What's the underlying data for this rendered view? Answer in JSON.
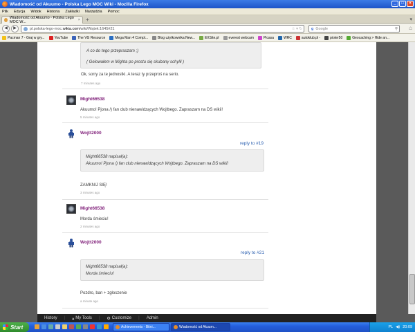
{
  "window": {
    "title": "Wiadomość od Akuumo - Polska Lego MOC Wiki - Mozilla Firefox"
  },
  "menu": [
    "Plik",
    "Edycja",
    "Widok",
    "Historia",
    "Zakładki",
    "Narzędzia",
    "Pomoc"
  ],
  "tab": {
    "label": "Wiadomość od Akuumo - Polska Lego MOC W...",
    "close": "×",
    "new_tab": "+"
  },
  "nav": {
    "url_prefix": "pl.polska-lego-moc.",
    "url_domain": "wikia.com",
    "url_suffix": "/wiki/Wątek:1645#21",
    "search_engine": "g",
    "search_placeholder": "Google"
  },
  "bookmarks": [
    {
      "label": "Pacman 7 - Graj w gry...",
      "color": "#f2c218"
    },
    {
      "label": "YouTube",
      "color": "#d22"
    },
    {
      "label": "The VG Resource",
      "color": "#3a63b8"
    },
    {
      "label": "Mega Man 4 Compl...",
      "color": "#2b6fc2"
    },
    {
      "label": "Blog użytkownika:New...",
      "color": "#888"
    },
    {
      "label": "EXSite.pl",
      "color": "#7a4"
    },
    {
      "label": "everest webcam",
      "color": "#999"
    },
    {
      "label": "Picasa",
      "color": "#c4c"
    },
    {
      "label": "WRC",
      "color": "#26a"
    },
    {
      "label": "autoklub.pl -",
      "color": "#c33"
    },
    {
      "label": "pioter50",
      "color": "#444"
    },
    {
      "label": "Geocaching > Hide an...",
      "color": "#5a3"
    }
  ],
  "thread": {
    "top_quote_lines": [
      "A co do tego przepraszam ;)",
      "( Gelowałem w Mighta po prostu się skubany schylił )"
    ],
    "top_text": "Ok, sorry za te jednostki. A teraz ty przeproś na serio.",
    "top_time": "7 minutes ago",
    "posts": [
      {
        "user": "Might66538",
        "text": "Akuumo! Pjona /) fan club nienawidzących Wojtbego. Zapraszam na DS wikii!",
        "time": "5 minutes ago"
      },
      {
        "user": "Wojtt2000",
        "reply": "reply to #19",
        "quote_lines": [
          "Might66538 napisał(a):",
          "Akuumo! Pjona /) fan club nienawidzących Wojtbego. Zapraszam na DS wikii!"
        ],
        "text": "ZAMKNIJ SIĘ!",
        "time": "3 minutes ago"
      },
      {
        "user": "Might66538",
        "text": "Morda śmieciu!",
        "time": "2 minutes ago"
      },
      {
        "user": "Wojtt2000",
        "reply": "reply to #21",
        "quote_lines": [
          "Might66538 napisał(a):",
          "Morda śmieciu!"
        ],
        "text": "Pozdro, ban + zgłoszenie",
        "time": "a minute ago"
      }
    ]
  },
  "wikia_toolbar": {
    "history": "History",
    "my_tools": "My Tools",
    "customize": "Customize",
    "admin": "Admin"
  },
  "taskbar": {
    "start": "Start",
    "buttons": [
      {
        "label": "Achievements - Bitni..."
      },
      {
        "label": "Wiadomość od Akuum..."
      }
    ],
    "lang": "PL",
    "clock": "20:09"
  },
  "colors": {
    "username": "#80207a",
    "reply_link": "#2a5fb0"
  }
}
